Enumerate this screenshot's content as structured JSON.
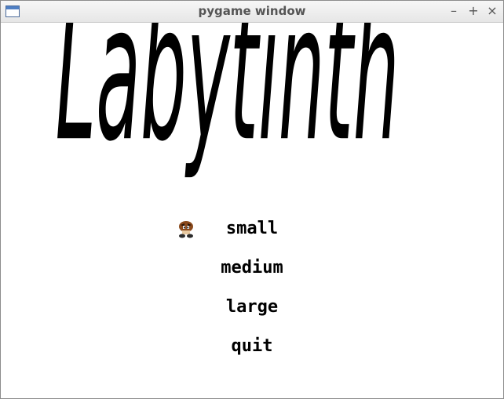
{
  "window": {
    "title": "pygame window",
    "minimize_label": "–",
    "maximize_label": "+",
    "close_label": "×"
  },
  "game": {
    "logo_text": "Labytinth",
    "cursor_icon": "goomba-icon",
    "menu_items": [
      {
        "label": "small",
        "selected": true
      },
      {
        "label": "medium",
        "selected": false
      },
      {
        "label": "large",
        "selected": false
      },
      {
        "label": "quit",
        "selected": false
      }
    ]
  },
  "colors": {
    "background": "#ffffff",
    "text": "#000000",
    "titlebar_text": "#555555"
  }
}
